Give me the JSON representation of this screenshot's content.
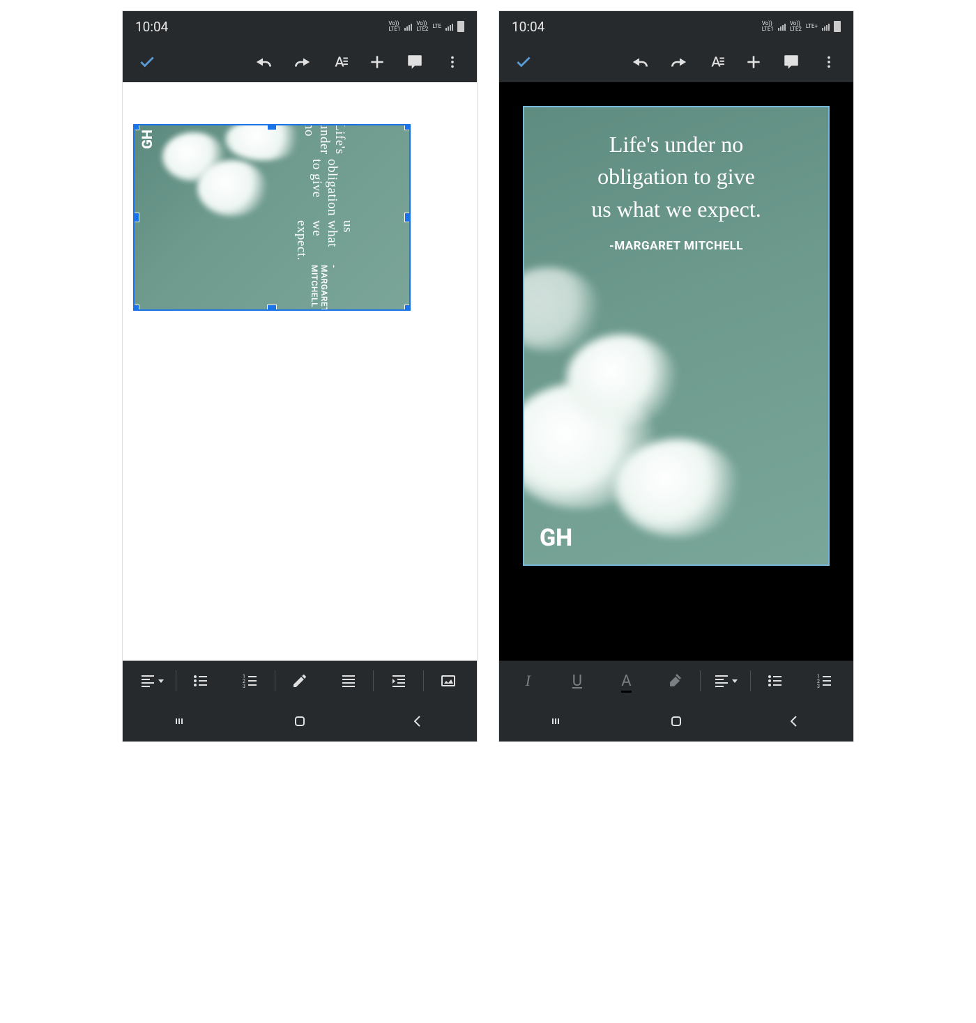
{
  "status": {
    "time": "10:04",
    "sim1": {
      "top": "Vo))",
      "bottom": "LTE1"
    },
    "sim2_left": {
      "top": "Vo))",
      "bottom": "LTE2"
    },
    "sim2_right": {
      "top": "Vo))",
      "bottom": "LTE2"
    },
    "net_right": "LTE",
    "net_right2": "LTE+"
  },
  "toolbar": {
    "done": "done",
    "undo": "undo",
    "redo": "redo",
    "text_format": "A",
    "add": "+",
    "comment": "comment",
    "more": "more"
  },
  "image_quote": {
    "line1": "Life's under no",
    "line2": "obligation to give",
    "line3": "us what we expect.",
    "attribution": "-MARGARET MITCHELL",
    "brand": "GH"
  },
  "bottom_left": {
    "align": "align",
    "bullets": "bullet-list",
    "numbers": "numbered-list",
    "edit": "edit",
    "justify": "justify",
    "indent": "indent",
    "image": "image"
  },
  "bottom_right": {
    "italic": "I",
    "underline": "U",
    "font_color": "A",
    "highlight": "highlight",
    "align": "align",
    "bullets": "bullet-list",
    "numbers": "numbered-list"
  },
  "nav": {
    "recents": "recents",
    "home": "home",
    "back": "back"
  },
  "colors": {
    "selection": "#1a73e8",
    "highlight_box": "#e1261c",
    "app_bg": "#262a2d",
    "teal": "#6d9a8d"
  }
}
